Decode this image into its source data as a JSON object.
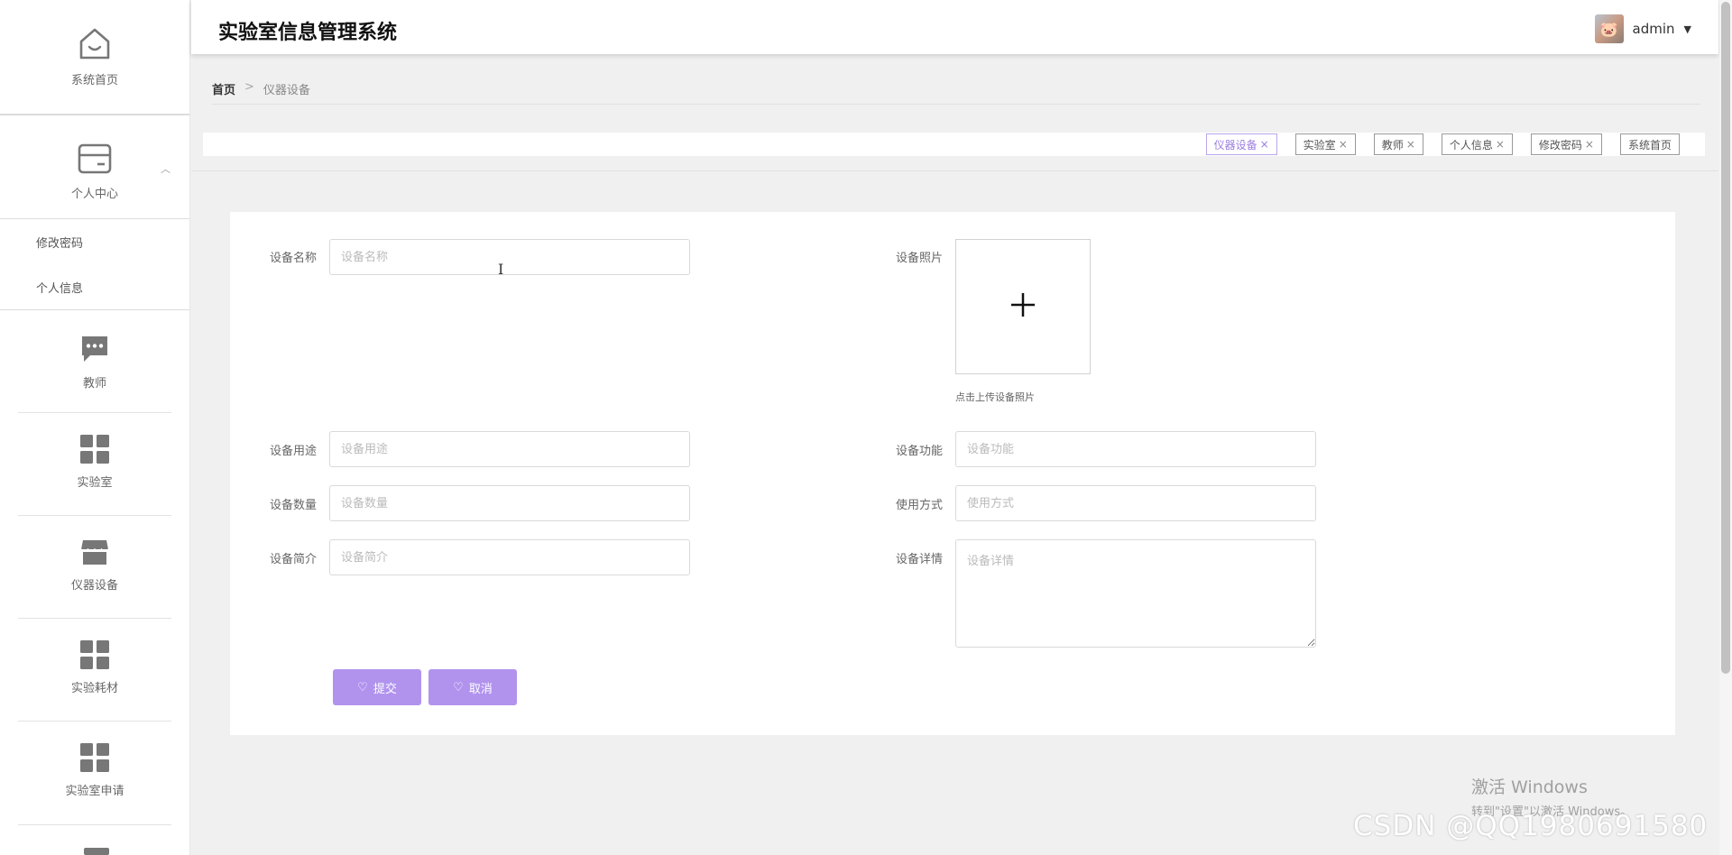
{
  "app": {
    "title": "实验室信息管理系统"
  },
  "user": {
    "name": "admin"
  },
  "sidebar": {
    "home": "系统首页",
    "personal_center": "个人中心",
    "sub_items": [
      "修改密码",
      "个人信息"
    ],
    "items": [
      "教师",
      "实验室",
      "仪器设备",
      "实验耗材",
      "实验室申请"
    ]
  },
  "breadcrumb": {
    "home": "首页",
    "separator": ">",
    "current": "仪器设备"
  },
  "tags": [
    {
      "label": "仪器设备",
      "active": true,
      "closable": true
    },
    {
      "label": "实验室",
      "active": false,
      "closable": true
    },
    {
      "label": "教师",
      "active": false,
      "closable": true
    },
    {
      "label": "个人信息",
      "active": false,
      "closable": true
    },
    {
      "label": "修改密码",
      "active": false,
      "closable": true
    },
    {
      "label": "系统首页",
      "active": false,
      "closable": false
    }
  ],
  "tag_close_glyph": "×",
  "form": {
    "name": {
      "label": "设备名称",
      "placeholder": "设备名称",
      "value": ""
    },
    "photo": {
      "label": "设备照片",
      "hint": "点击上传设备照片"
    },
    "usage": {
      "label": "设备用途",
      "placeholder": "设备用途",
      "value": ""
    },
    "function": {
      "label": "设备功能",
      "placeholder": "设备功能",
      "value": ""
    },
    "quantity": {
      "label": "设备数量",
      "placeholder": "设备数量",
      "value": ""
    },
    "method": {
      "label": "使用方式",
      "placeholder": "使用方式",
      "value": ""
    },
    "intro": {
      "label": "设备简介",
      "placeholder": "设备简介",
      "value": ""
    },
    "detail": {
      "label": "设备详情",
      "placeholder": "设备详情",
      "value": ""
    },
    "submit": "提交",
    "cancel": "取消"
  },
  "overlay": {
    "windows_line1": "激活 Windows",
    "windows_line2": "转到\"设置\"以激活 Windows。",
    "watermark": "CSDN @QQ1980691580"
  },
  "colors": {
    "accent": "#b193ee",
    "accent_text": "#9b7de0",
    "icon": "#888888"
  }
}
